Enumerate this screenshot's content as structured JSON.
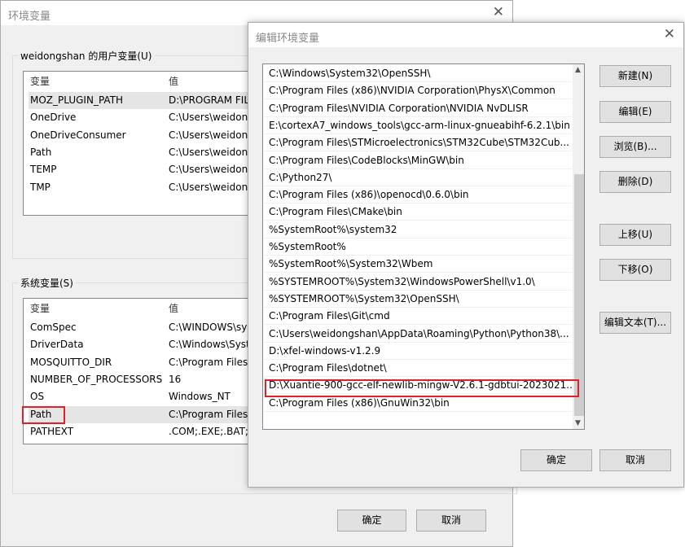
{
  "bg_dialog": {
    "title": "环境变量",
    "user_group": "weidongshan 的用户变量(U)",
    "sys_group": "系统变量(S)",
    "col_var": "变量",
    "col_val": "值",
    "user_vars": [
      [
        "MOZ_PLUGIN_PATH",
        "D:\\PROGRAM FIL"
      ],
      [
        "OneDrive",
        "C:\\Users\\weidon"
      ],
      [
        "OneDriveConsumer",
        "C:\\Users\\weidon"
      ],
      [
        "Path",
        "C:\\Users\\weidon"
      ],
      [
        "TEMP",
        "C:\\Users\\weidon"
      ],
      [
        "TMP",
        "C:\\Users\\weidon"
      ]
    ],
    "sys_vars": [
      [
        "ComSpec",
        "C:\\WINDOWS\\sy"
      ],
      [
        "DriverData",
        "C:\\Windows\\Syst"
      ],
      [
        "MOSQUITTO_DIR",
        "C:\\Program Files"
      ],
      [
        "NUMBER_OF_PROCESSORS",
        "16"
      ],
      [
        "OS",
        "Windows_NT"
      ],
      [
        "Path",
        "C:\\Program Files"
      ],
      [
        "PATHEXT",
        ".COM;.EXE;.BAT;."
      ]
    ],
    "ok": "确定",
    "cancel": "取消"
  },
  "fg_dialog": {
    "title": "编辑环境变量",
    "paths": [
      "C:\\Windows\\System32\\OpenSSH\\",
      "C:\\Program Files (x86)\\NVIDIA Corporation\\PhysX\\Common",
      "C:\\Program Files\\NVIDIA Corporation\\NVIDIA NvDLISR",
      "E:\\cortexA7_windows_tools\\gcc-arm-linux-gnueabihf-6.2.1\\bin",
      "C:\\Program Files\\STMicroelectronics\\STM32Cube\\STM32Cub...",
      "C:\\Program Files\\CodeBlocks\\MinGW\\bin",
      "C:\\Python27\\",
      "C:\\Program Files (x86)\\openocd\\0.6.0\\bin",
      "C:\\Program Files\\CMake\\bin",
      "%SystemRoot%\\system32",
      "%SystemRoot%",
      "%SystemRoot%\\System32\\Wbem",
      "%SYSTEMROOT%\\System32\\WindowsPowerShell\\v1.0\\",
      "%SYSTEMROOT%\\System32\\OpenSSH\\",
      "C:\\Program Files\\Git\\cmd",
      "C:\\Users\\weidongshan\\AppData\\Roaming\\Python\\Python38\\...",
      "D:\\xfel-windows-v1.2.9",
      "C:\\Program Files\\dotnet\\",
      "D:\\Xuantie-900-gcc-elf-newlib-mingw-V2.6.1-gdbtui-2023021...",
      "C:\\Program Files (x86)\\GnuWin32\\bin"
    ],
    "buttons": {
      "new": "新建(N)",
      "edit": "编辑(E)",
      "browse": "浏览(B)...",
      "delete": "删除(D)",
      "up": "上移(U)",
      "down": "下移(O)",
      "edit_text": "编辑文本(T)...",
      "ok": "确定",
      "cancel": "取消"
    }
  },
  "highlight_color": "#e0202a"
}
